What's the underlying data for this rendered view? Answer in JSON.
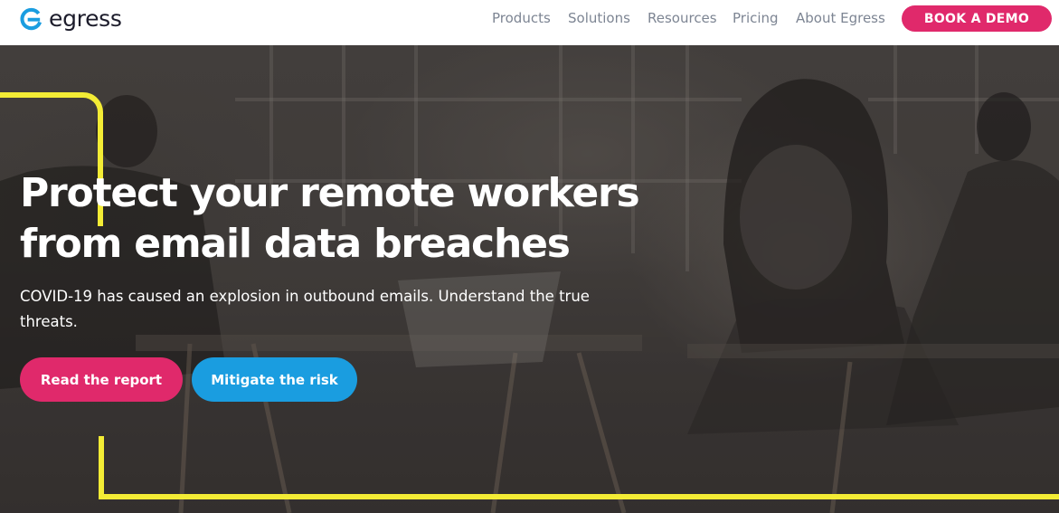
{
  "brand": {
    "name": "egress",
    "logo_icon": "egress-logo-icon",
    "logo_color": "#1a9de0"
  },
  "nav": {
    "items": [
      {
        "label": "Products"
      },
      {
        "label": "Solutions"
      },
      {
        "label": "Resources"
      },
      {
        "label": "Pricing"
      },
      {
        "label": "About Egress"
      }
    ],
    "cta_label": "BOOK A DEMO"
  },
  "hero": {
    "title": "Protect your remote workers from email data breaches",
    "subtitle": "COVID-19 has caused an explosion in outbound emails. Understand the true threats.",
    "primary_cta": "Read the report",
    "secondary_cta": "Mitigate the risk"
  },
  "colors": {
    "accent_pink": "#e0296b",
    "accent_blue": "#1a9de0",
    "frame_yellow": "#f3ec35",
    "nav_text": "#7d8593"
  }
}
